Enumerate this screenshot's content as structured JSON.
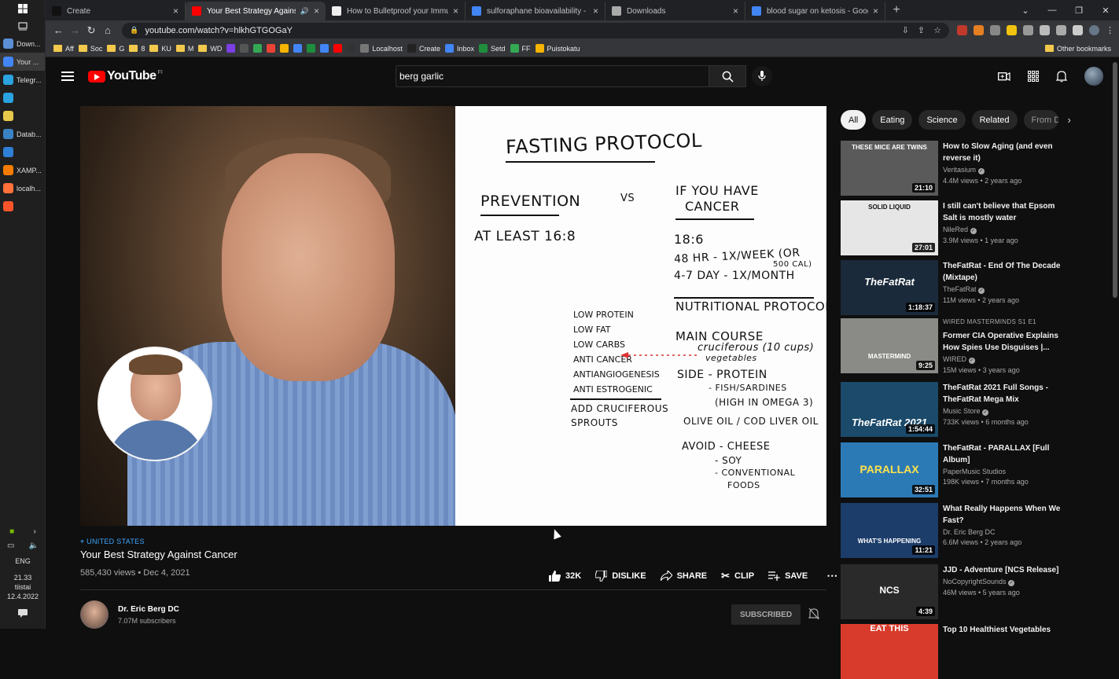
{
  "taskbar": {
    "items": [
      {
        "label": "Down...",
        "color": "#5a8fd6"
      },
      {
        "label": "Your ...",
        "color": "#4285f4",
        "active": true
      },
      {
        "label": "Telegr...",
        "color": "#2aa3e0"
      },
      {
        "label": "",
        "color": "#2aa3e0"
      },
      {
        "label": "",
        "color": "#e8c84a"
      },
      {
        "label": "Datab...",
        "color": "#3b82c4"
      },
      {
        "label": "",
        "color": "#2f7fd6"
      },
      {
        "label": "XAMP...",
        "color": "#f57c00"
      },
      {
        "label": "localh...",
        "color": "#ff7139"
      },
      {
        "label": "",
        "color": "#fb542b"
      }
    ],
    "lang": "ENG",
    "time": "21.33",
    "day": "tiistai",
    "date": "12.4.2022"
  },
  "tabs": [
    {
      "title": "Create",
      "fav": "#111",
      "active": false
    },
    {
      "title": "Your Best Strategy Against C",
      "fav": "#ff0000",
      "active": true
    },
    {
      "title": "How to Bulletproof your Immune",
      "fav": "#eee",
      "active": false
    },
    {
      "title": "sulforaphane bioavailability - Goo",
      "fav": "#4285f4",
      "active": false
    },
    {
      "title": "Downloads",
      "fav": "#aaa",
      "active": false
    },
    {
      "title": "blood sugar on ketosis - Google",
      "fav": "#4285f4",
      "active": false
    }
  ],
  "url": "youtube.com/watch?v=hlkhGTGOGaY",
  "bookmarks": [
    "Aff",
    "Soc",
    "G",
    "8",
    "KU",
    "M",
    "WD",
    "Localhost",
    "Create",
    "Inbox",
    "Setd",
    "FF",
    "Puistokatu"
  ],
  "bookmarks_other": "Other bookmarks",
  "youtube": {
    "region": "FI",
    "search_value": "berg garlic"
  },
  "whiteboard": {
    "title": "FASTING PROTOCOL",
    "prevention": "PREVENTION",
    "vs": "VS",
    "cancer_header_1": "IF YOU HAVE",
    "cancer_header_2": "CANCER",
    "at_least": "AT LEAST 16:8",
    "c_18_6": "18:6",
    "c_48hr": "48 HR - 1X/WEEK (OR",
    "c_500": "500 CAL)",
    "c_47day": "4-7 DAY - 1X/MONTH",
    "nutritional": "NUTRITIONAL PROTOCOL",
    "left_list": [
      "LOW PROTEIN",
      "LOW FAT",
      "LOW CARBS",
      "ANTI CANCER",
      "ANTIANGIOGENESIS",
      "ANTI ESTROGENIC"
    ],
    "add_1": "ADD CRUCIFEROUS",
    "add_2": "SPROUTS",
    "main_course": "MAIN COURSE",
    "cruciferous": "cruciferous (10 cups)",
    "vegetables": "vegetables",
    "side_protein": "SIDE - PROTEIN",
    "fish": "- FISH/SARDINES",
    "omega": "(HIGH IN OMEGA 3)",
    "olive": "OLIVE OIL / COD LIVER OIL",
    "avoid": "AVOID - CHEESE",
    "soy": "- SOY",
    "conventional": "- CONVENTIONAL",
    "foods": "FOODS"
  },
  "video": {
    "location": "UNITED STATES",
    "title": "Your Best Strategy Against Cancer",
    "views": "585,430 views",
    "date": "Dec 4, 2021",
    "likes": "32K",
    "dislike": "DISLIKE",
    "share": "SHARE",
    "clip": "CLIP",
    "save": "SAVE"
  },
  "channel": {
    "name": "Dr. Eric Berg DC",
    "subscribers": "7.07M subscribers",
    "subscribed_label": "SUBSCRIBED"
  },
  "chips": [
    "All",
    "Eating",
    "Science",
    "Related",
    "From D"
  ],
  "recommendations": [
    {
      "title": "How to Slow Aging (and even reverse it)",
      "channel": "Veritasium",
      "verified": true,
      "views": "4.4M views",
      "age": "2 years ago",
      "duration": "21:10",
      "thumb_text": "THESE MICE ARE TWINS",
      "bg": "#5a5a5a"
    },
    {
      "title": "I still can't believe that Epsom Salt is mostly water",
      "channel": "NileRed",
      "verified": true,
      "views": "3.9M views",
      "age": "1 year ago",
      "duration": "27:01",
      "thumb_text": "SOLID      LIQUID",
      "bg": "#e6e6e6"
    },
    {
      "title": "TheFatRat - End Of The Decade (Mixtape)",
      "channel": "TheFatRat",
      "verified": true,
      "views": "11M views",
      "age": "2 years ago",
      "duration": "1:18:37",
      "thumb_text": "TheFatRat",
      "bg": "#1b2a3a"
    },
    {
      "tag": "WIRED MASTERMINDS  S1 E1",
      "title": "Former CIA Operative Explains How Spies Use Disguises |...",
      "channel": "WIRED",
      "verified": true,
      "views": "15M views",
      "age": "3 years ago",
      "duration": "9:25",
      "thumb_text": "MASTERMIND",
      "bg": "#8a8a86"
    },
    {
      "title": "TheFatRat 2021 Full Songs - TheFatRat Mega Mix",
      "channel": "Music Store",
      "verified": true,
      "views": "733K views",
      "age": "6 months ago",
      "duration": "1:54:44",
      "thumb_text": "TheFatRat 2021",
      "bg": "#1b4a6a"
    },
    {
      "title": "TheFatRat - PARALLAX [Full Album]",
      "channel": "PaperMusic Studios",
      "verified": false,
      "views": "198K views",
      "age": "7 months ago",
      "duration": "32:51",
      "thumb_text": "PARALLAX",
      "bg": "#2c7ab5"
    },
    {
      "title": "What Really Happens When We Fast?",
      "channel": "Dr. Eric Berg DC",
      "verified": false,
      "views": "6.6M views",
      "age": "2 years ago",
      "duration": "11:21",
      "thumb_text": "WHAT'S HAPPENING",
      "bg": "#1c3d6a"
    },
    {
      "title": "JJD - Adventure [NCS Release]",
      "channel": "NoCopyrightSounds",
      "verified": true,
      "views": "46M views",
      "age": "5 years ago",
      "duration": "4:39",
      "thumb_text": "NCS",
      "bg": "#2a2a2a"
    },
    {
      "title": "Top 10 Healthiest Vegetables",
      "channel": "",
      "verified": false,
      "views": "",
      "age": "",
      "duration": "",
      "thumb_text": "EAT THIS",
      "bg": "#d83b2b"
    }
  ]
}
